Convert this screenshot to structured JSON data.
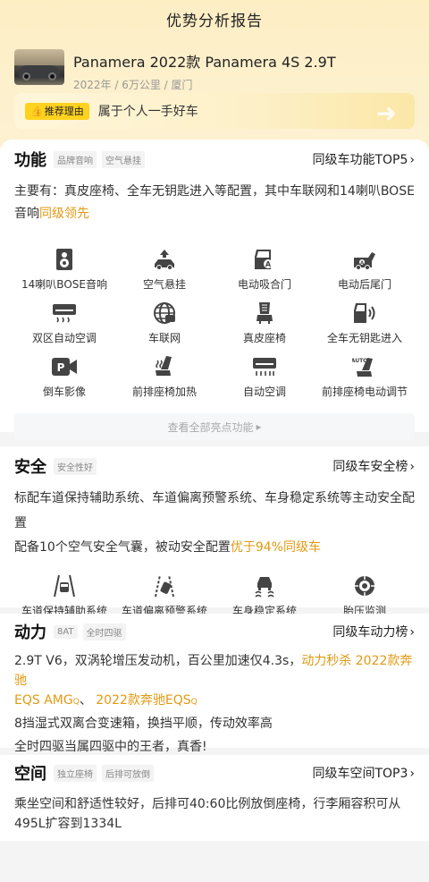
{
  "page": {
    "title": "优势分析报告"
  },
  "car": {
    "name": "Panamera 2022款 Panamera 4S 2.9T",
    "meta": "2022年 / 6万公里 / 厦门"
  },
  "reason": {
    "tag": "推荐理由",
    "text": "属于个人一手好车"
  },
  "features": {
    "title": "功能",
    "tags": [
      "品牌音响",
      "空气悬挂"
    ],
    "link": "同级车功能TOP5",
    "desc_prefix": "主要有：真皮座椅、全车无钥匙进入等配置，其中车联网和14喇叭BOSE音响",
    "desc_highlight": "同级领先",
    "items": [
      {
        "label": "14喇叭BOSE音响",
        "icon": "speaker-icon"
      },
      {
        "label": "空气悬挂",
        "icon": "air-suspension-icon"
      },
      {
        "label": "电动吸合门",
        "icon": "soft-close-door-icon"
      },
      {
        "label": "电动后尾门",
        "icon": "power-tailgate-icon"
      },
      {
        "label": "双区自动空调",
        "icon": "dual-zone-ac-icon"
      },
      {
        "label": "车联网",
        "icon": "connected-car-icon"
      },
      {
        "label": "真皮座椅",
        "icon": "leather-seat-icon"
      },
      {
        "label": "全车无钥匙进入",
        "icon": "keyless-entry-icon"
      },
      {
        "label": "倒车影像",
        "icon": "reverse-camera-icon"
      },
      {
        "label": "前排座椅加热",
        "icon": "seat-heating-icon"
      },
      {
        "label": "自动空调",
        "icon": "auto-ac-icon"
      },
      {
        "label": "前排座椅电动调节",
        "icon": "power-seat-icon"
      }
    ],
    "more": "查看全部亮点功能"
  },
  "safety": {
    "title": "安全",
    "tags": [
      "安全性好"
    ],
    "link": "同级车安全榜",
    "line1": "标配车道保持辅助系统、车道偏离预警系统、车身稳定系统等主动安全配置",
    "line2_prefix": "配备10个空气安全气囊，被动安全配置",
    "line2_highlight": "优于94%同级车",
    "items": [
      {
        "label": "车道保持辅助系统",
        "icon": "lane-keep-icon"
      },
      {
        "label": "车道偏离预警系统",
        "icon": "lane-departure-icon"
      },
      {
        "label": "车身稳定系统",
        "icon": "stability-icon"
      },
      {
        "label": "胎压监测",
        "icon": "tire-pressure-icon"
      }
    ]
  },
  "power": {
    "title": "动力",
    "tags": [
      "8AT",
      "全时四驱"
    ],
    "link": "同级车动力榜",
    "line1_prefix": "2.9T V6，双涡轮增压发动机，百公里加速仅4.3s，",
    "line1_hl1": "动力秒杀",
    "line1_hl2": "2022款奔驰",
    "line2_hl": "EQS AMG",
    "line2_sep": "、",
    "line2_hl2": "2022款奔驰EQS",
    "line3": "8挡湿式双离合变速箱，换挡平顺，传动效率高",
    "line4": "全时四驱当属四驱中的王者，真香!"
  },
  "space": {
    "title": "空间",
    "tags": [
      "独立座椅",
      "后排可放倒"
    ],
    "link": "同级车空间TOP3",
    "desc": "乘坐空间和舒适性较好，后排可40:60比例放倒座椅，行李厢容积可从495L扩容到1334L"
  },
  "colors": {
    "accent": "#e09a12",
    "tag_yellow": "#ffd21e",
    "icon": "#444444"
  }
}
